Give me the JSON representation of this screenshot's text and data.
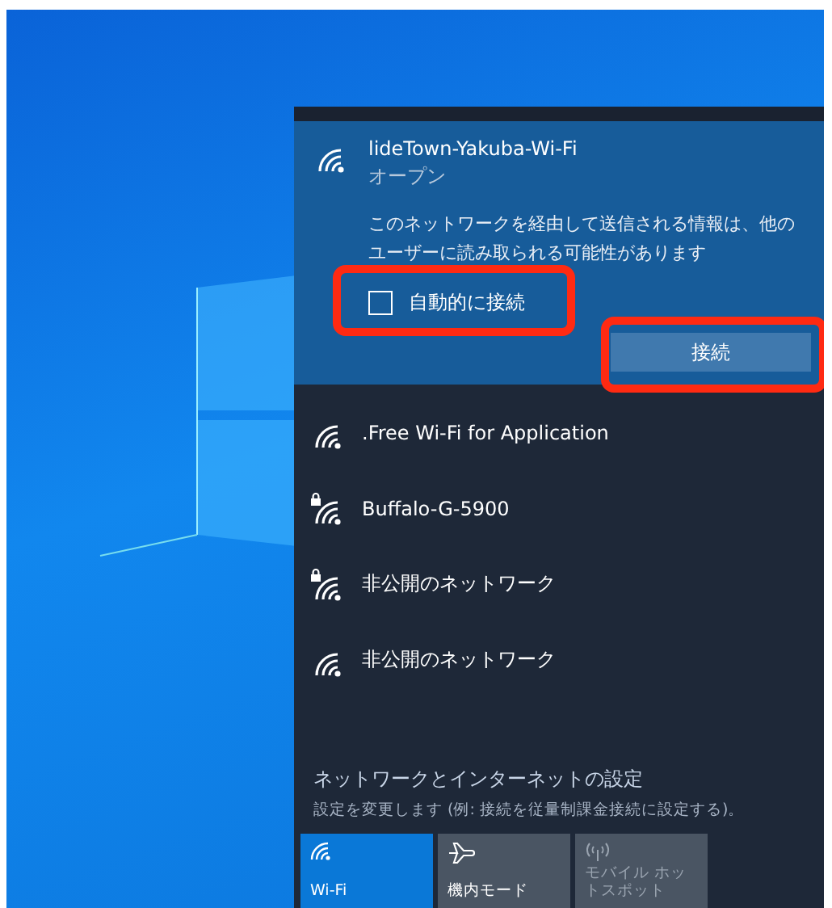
{
  "selected_network": {
    "name": "lideTown-Yakuba-Wi-Fi",
    "status": "オープン",
    "warning": "このネットワークを経由して送信される情報は、他のユーザーに読み取られる可能性があります",
    "auto_connect": {
      "label": "自動的に接続",
      "checked": false
    },
    "connect_button": "接続"
  },
  "networks": [
    {
      "name": ".Free Wi-Fi for Application",
      "secured": false
    },
    {
      "name": "Buffalo-G-5900",
      "secured": true
    },
    {
      "name": "非公開のネットワーク",
      "secured": true
    },
    {
      "name": "非公開のネットワーク",
      "secured": false
    }
  ],
  "settings": {
    "link": "ネットワークとインターネットの設定",
    "description": "設定を変更します (例: 接続を従量制課金接続に設定する)。"
  },
  "quick_actions": [
    {
      "kind": "wifi",
      "label": "Wi-Fi",
      "on": true,
      "disabled": false
    },
    {
      "kind": "airplane",
      "label": "機内モード",
      "on": false,
      "disabled": false
    },
    {
      "kind": "hotspot",
      "label": "モバイル ホットスポット",
      "on": false,
      "disabled": true
    }
  ]
}
